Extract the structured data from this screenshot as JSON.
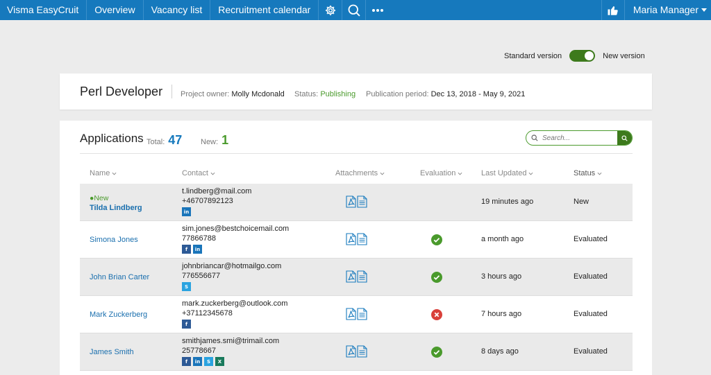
{
  "nav": {
    "brand": "Visma EasyCruit",
    "links": [
      "Overview",
      "Vacancy list",
      "Recruitment calendar"
    ],
    "user": "Maria Manager"
  },
  "version": {
    "standard": "Standard version",
    "new": "New version",
    "new_enabled": true
  },
  "project": {
    "title": "Perl Developer",
    "owner_label": "Project owner:",
    "owner": "Molly Mcdonald",
    "status_label": "Status:",
    "status": "Publishing",
    "period_label": "Publication period:",
    "period": "Dec 13, 2018 - May 9, 2021"
  },
  "applications": {
    "title": "Applications",
    "total_label": "Total:",
    "total": "47",
    "new_label": "New:",
    "new": "1",
    "search_placeholder": "Search...",
    "columns": {
      "name": "Name",
      "contact": "Contact",
      "attachments": "Attachments",
      "evaluation": "Evaluation",
      "updated": "Last Updated",
      "status": "Status"
    },
    "rows": [
      {
        "tag": "New",
        "name": "Tilda Lindberg",
        "email": "t.lindberg@mail.com",
        "phone": "+46707892123",
        "socials": [
          "linkedin"
        ],
        "evaluation": "",
        "updated": "19 minutes ago",
        "status": "New"
      },
      {
        "tag": "",
        "name": "Simona Jones",
        "email": "sim.jones@bestchoicemail.com",
        "phone": "77866788",
        "socials": [
          "facebook",
          "linkedin"
        ],
        "evaluation": "approved",
        "updated": "a month ago",
        "status": "Evaluated"
      },
      {
        "tag": "",
        "name": "John Brian Carter",
        "email": "johnbriancar@hotmailgo.com",
        "phone": "776556677",
        "socials": [
          "skype"
        ],
        "evaluation": "approved",
        "updated": "3 hours ago",
        "status": "Evaluated"
      },
      {
        "tag": "",
        "name": "Mark Zuckerberg",
        "email": "mark.zuckerberg@outlook.com",
        "phone": "+37112345678",
        "socials": [
          "facebook"
        ],
        "evaluation": "rejected",
        "updated": "7 hours ago",
        "status": "Evaluated"
      },
      {
        "tag": "",
        "name": "James Smith",
        "email": "smithjames.smi@trimail.com",
        "phone": "25778667",
        "socials": [
          "facebook",
          "linkedin",
          "skype",
          "xing"
        ],
        "evaluation": "approved",
        "updated": "8 days ago",
        "status": "Evaluated"
      }
    ]
  },
  "colors": {
    "nav": "#1679bd",
    "accent_green": "#4a9a2c",
    "toggle": "#3d7a1c",
    "link": "#1a6fae"
  }
}
